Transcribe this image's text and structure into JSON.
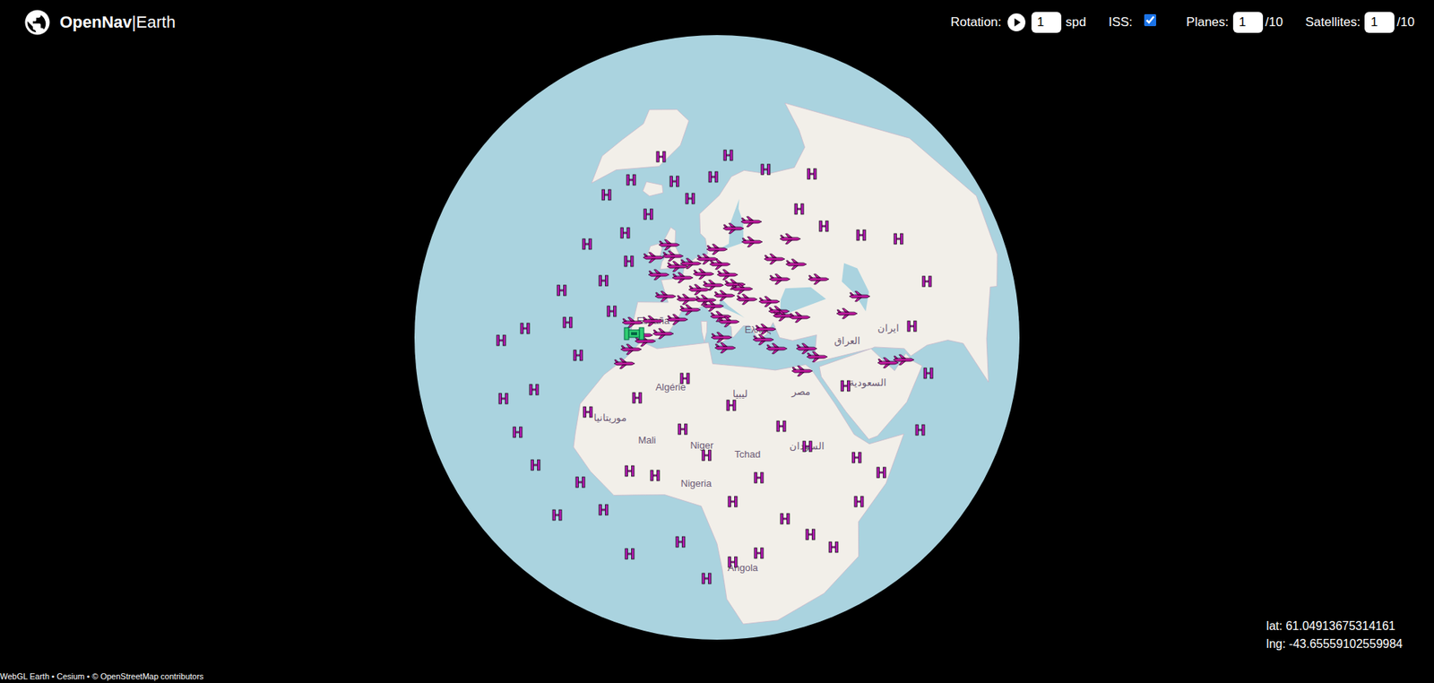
{
  "app": {
    "brand": "OpenNav",
    "brand_suffix": "|Earth"
  },
  "controls": {
    "rotation": {
      "label": "Rotation:",
      "playing": false,
      "value": "1",
      "unit": "spd"
    },
    "iss": {
      "label": "ISS:",
      "checked": true
    },
    "planes": {
      "label": "Planes:",
      "value": "1",
      "max": "/10"
    },
    "satellites": {
      "label": "Satellites:",
      "value": "1",
      "max": "/10"
    }
  },
  "map_labels": [
    {
      "text": "España",
      "lat": 40,
      "lng": -4
    },
    {
      "text": "Algérie",
      "lat": 28,
      "lng": 2
    },
    {
      "text": "Mali",
      "lat": 17,
      "lng": -2
    },
    {
      "text": "Niger",
      "lat": 17,
      "lng": 9
    },
    {
      "text": "Tchad",
      "lat": 15,
      "lng": 18
    },
    {
      "text": "Nigeria",
      "lat": 9,
      "lng": 8
    },
    {
      "text": "Ελλάς",
      "lat": 39,
      "lng": 22
    },
    {
      "text": "ليبيا",
      "lat": 27,
      "lng": 17
    },
    {
      "text": "مصر",
      "lat": 26,
      "lng": 30
    },
    {
      "text": "السودان",
      "lat": 15,
      "lng": 30
    },
    {
      "text": "السعودية",
      "lat": 24,
      "lng": 45
    },
    {
      "text": "ایران",
      "lat": 32,
      "lng": 54
    },
    {
      "text": "العراق",
      "lat": 33,
      "lng": 43
    },
    {
      "text": "موريتانيا",
      "lat": 20,
      "lng": -10
    },
    {
      "text": "Angola",
      "lat": -12,
      "lng": 17
    }
  ],
  "markers": [
    {
      "kind": "plane",
      "lat": 51,
      "lng": 0
    },
    {
      "kind": "plane",
      "lat": 52,
      "lng": 4
    },
    {
      "kind": "plane",
      "lat": 50,
      "lng": 8
    },
    {
      "kind": "plane",
      "lat": 48,
      "lng": 11
    },
    {
      "kind": "plane",
      "lat": 49,
      "lng": 2
    },
    {
      "kind": "plane",
      "lat": 47,
      "lng": 7
    },
    {
      "kind": "plane",
      "lat": 46,
      "lng": 14
    },
    {
      "kind": "plane",
      "lat": 45,
      "lng": 9
    },
    {
      "kind": "plane",
      "lat": 44,
      "lng": 11
    },
    {
      "kind": "plane",
      "lat": 52,
      "lng": 13
    },
    {
      "kind": "plane",
      "lat": 53,
      "lng": 9
    },
    {
      "kind": "plane",
      "lat": 55,
      "lng": 12
    },
    {
      "kind": "plane",
      "lat": 50,
      "lng": 15
    },
    {
      "kind": "plane",
      "lat": 48,
      "lng": 17
    },
    {
      "kind": "plane",
      "lat": 47,
      "lng": 19
    },
    {
      "kind": "plane",
      "lat": 45,
      "lng": 20
    },
    {
      "kind": "plane",
      "lat": 44,
      "lng": 26
    },
    {
      "kind": "plane",
      "lat": 42,
      "lng": 28
    },
    {
      "kind": "plane",
      "lat": 41,
      "lng": 29
    },
    {
      "kind": "plane",
      "lat": 40,
      "lng": 33
    },
    {
      "kind": "plane",
      "lat": 39,
      "lng": 24
    },
    {
      "kind": "plane",
      "lat": 37,
      "lng": 23
    },
    {
      "kind": "plane",
      "lat": 41,
      "lng": 2
    },
    {
      "kind": "plane",
      "lat": 40,
      "lng": -4
    },
    {
      "kind": "plane",
      "lat": 38,
      "lng": -1
    },
    {
      "kind": "plane",
      "lat": 43,
      "lng": 5
    },
    {
      "kind": "plane",
      "lat": 45,
      "lng": 4
    },
    {
      "kind": "plane",
      "lat": 37,
      "lng": -6
    },
    {
      "kind": "plane",
      "lat": 36,
      "lng": -5
    },
    {
      "kind": "plane",
      "lat": 39,
      "lng": -9
    },
    {
      "kind": "plane",
      "lat": 53,
      "lng": -2
    },
    {
      "kind": "plane",
      "lat": 55,
      "lng": -4
    },
    {
      "kind": "plane",
      "lat": 56,
      "lng": 24
    },
    {
      "kind": "plane",
      "lat": 59,
      "lng": 18
    },
    {
      "kind": "plane",
      "lat": 60,
      "lng": 25
    },
    {
      "kind": "plane",
      "lat": 55,
      "lng": 37
    },
    {
      "kind": "plane",
      "lat": 52,
      "lng": 30
    },
    {
      "kind": "plane",
      "lat": 50,
      "lng": 36
    },
    {
      "kind": "plane",
      "lat": 48,
      "lng": 30
    },
    {
      "kind": "plane",
      "lat": 46,
      "lng": 41
    },
    {
      "kind": "plane",
      "lat": 42,
      "lng": 13
    },
    {
      "kind": "plane",
      "lat": 41,
      "lng": 15
    },
    {
      "kind": "plane",
      "lat": 38,
      "lng": 13
    },
    {
      "kind": "plane",
      "lat": 36,
      "lng": 14
    },
    {
      "kind": "plane",
      "lat": 35,
      "lng": 26
    },
    {
      "kind": "plane",
      "lat": 34,
      "lng": 33
    },
    {
      "kind": "plane",
      "lat": 32,
      "lng": 35
    },
    {
      "kind": "plane",
      "lat": 30,
      "lng": 31
    },
    {
      "kind": "plane",
      "lat": 25,
      "lng": 55
    },
    {
      "kind": "plane",
      "lat": 26,
      "lng": 51
    },
    {
      "kind": "plane",
      "lat": 40,
      "lng": 50
    },
    {
      "kind": "plane",
      "lat": 38,
      "lng": 45
    },
    {
      "kind": "plane",
      "lat": 34,
      "lng": -8
    },
    {
      "kind": "plane",
      "lat": 31,
      "lng": -9
    },
    {
      "kind": "plane",
      "lat": 45,
      "lng": -2
    },
    {
      "kind": "plane",
      "lat": 49,
      "lng": -5
    },
    {
      "kind": "plane",
      "lat": 52,
      "lng": -8
    },
    {
      "kind": "satellite",
      "lat": -5,
      "lng": -20
    },
    {
      "kind": "satellite",
      "lat": 0,
      "lng": -10
    },
    {
      "kind": "satellite",
      "lat": 5,
      "lng": -25
    },
    {
      "kind": "satellite",
      "lat": 10,
      "lng": -30
    },
    {
      "kind": "satellite",
      "lat": 15,
      "lng": -35
    },
    {
      "kind": "satellite",
      "lat": 20,
      "lng": -28
    },
    {
      "kind": "satellite",
      "lat": 25,
      "lng": -40
    },
    {
      "kind": "satellite",
      "lat": 30,
      "lng": -35
    },
    {
      "kind": "satellite",
      "lat": 35,
      "lng": -25
    },
    {
      "kind": "satellite",
      "lat": 40,
      "lng": -30
    },
    {
      "kind": "satellite",
      "lat": 45,
      "lng": -20
    },
    {
      "kind": "satellite",
      "lat": 50,
      "lng": -30
    },
    {
      "kind": "satellite",
      "lat": 55,
      "lng": -20
    },
    {
      "kind": "satellite",
      "lat": 60,
      "lng": -15
    },
    {
      "kind": "satellite",
      "lat": 60,
      "lng": -35
    },
    {
      "kind": "satellite",
      "lat": 65,
      "lng": -30
    },
    {
      "kind": "satellite",
      "lat": 50,
      "lng": -15
    },
    {
      "kind": "satellite",
      "lat": 40,
      "lng": -15
    },
    {
      "kind": "satellite",
      "lat": 30,
      "lng": -20
    },
    {
      "kind": "satellite",
      "lat": 20,
      "lng": -15
    },
    {
      "kind": "satellite",
      "lat": 10,
      "lng": -5
    },
    {
      "kind": "satellite",
      "lat": 5,
      "lng": 15
    },
    {
      "kind": "satellite",
      "lat": 0,
      "lng": 25
    },
    {
      "kind": "satellite",
      "lat": -5,
      "lng": 30
    },
    {
      "kind": "satellite",
      "lat": -8,
      "lng": 20
    },
    {
      "kind": "satellite",
      "lat": 10,
      "lng": 20
    },
    {
      "kind": "satellite",
      "lat": 20,
      "lng": 25
    },
    {
      "kind": "satellite",
      "lat": 15,
      "lng": 30
    },
    {
      "kind": "satellite",
      "lat": 25,
      "lng": 40
    },
    {
      "kind": "satellite",
      "lat": 10,
      "lng": 40
    },
    {
      "kind": "satellite",
      "lat": 5,
      "lng": 45
    },
    {
      "kind": "satellite",
      "lat": 0,
      "lng": 40
    },
    {
      "kind": "satellite",
      "lat": -10,
      "lng": 35
    },
    {
      "kind": "satellite",
      "lat": 20,
      "lng": 5
    },
    {
      "kind": "satellite",
      "lat": 25,
      "lng": -5
    },
    {
      "kind": "satellite",
      "lat": 10,
      "lng": 0
    },
    {
      "kind": "satellite",
      "lat": 30,
      "lng": 5
    },
    {
      "kind": "satellite",
      "lat": 15,
      "lng": 10
    },
    {
      "kind": "satellite",
      "lat": -10,
      "lng": -5
    },
    {
      "kind": "satellite",
      "lat": -5,
      "lng": 5
    },
    {
      "kind": "satellite",
      "lat": 5,
      "lng": -15
    },
    {
      "kind": "satellite",
      "lat": 65,
      "lng": 0
    },
    {
      "kind": "satellite",
      "lat": 70,
      "lng": 10
    },
    {
      "kind": "satellite",
      "lat": 75,
      "lng": 20
    },
    {
      "kind": "satellite",
      "lat": 70,
      "lng": 40
    },
    {
      "kind": "satellite",
      "lat": 65,
      "lng": 60
    },
    {
      "kind": "satellite",
      "lat": 55,
      "lng": 50
    },
    {
      "kind": "satellite",
      "lat": 50,
      "lng": 60
    },
    {
      "kind": "satellite",
      "lat": 45,
      "lng": 70
    },
    {
      "kind": "satellite",
      "lat": 35,
      "lng": 70
    },
    {
      "kind": "satellite",
      "lat": 30,
      "lng": 60
    },
    {
      "kind": "satellite",
      "lat": 20,
      "lng": 60
    },
    {
      "kind": "satellite",
      "lat": 10,
      "lng": 55
    },
    {
      "kind": "satellite",
      "lat": 60,
      "lng": 45
    },
    {
      "kind": "satellite",
      "lat": 68,
      "lng": -10
    },
    {
      "kind": "satellite",
      "lat": 72,
      "lng": -25
    },
    {
      "kind": "satellite",
      "lat": -15,
      "lng": 10
    },
    {
      "kind": "satellite",
      "lat": -10,
      "lng": 15
    },
    {
      "kind": "satellite",
      "lat": 25,
      "lng": 15
    }
  ],
  "iss_marker": {
    "lat": 37,
    "lng": -8
  },
  "cursor": {
    "lat": "lat: 61.04913675314161",
    "lng": "lng: -43.65559102559984"
  },
  "attribution": "WebGL Earth • Cesium • © OpenStreetMap contributors"
}
